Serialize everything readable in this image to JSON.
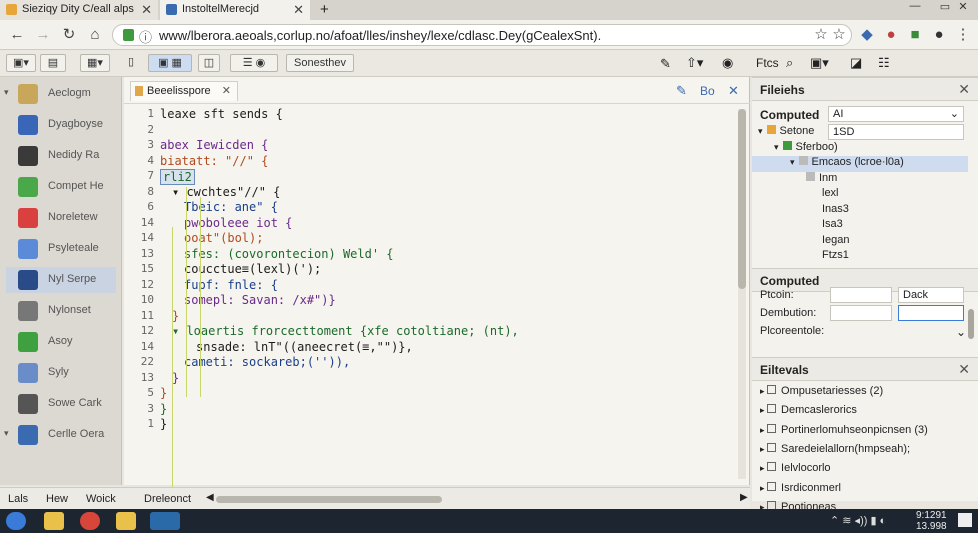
{
  "tabs": [
    {
      "title": "Sieziqy Dity C/eall alps"
    },
    {
      "title": "InstoltelMerecjd"
    }
  ],
  "new_tab_symbol": "+",
  "close_symbol": "✕",
  "address": {
    "url": "www/lberora.aeoals,corlup.no/afoat/lles/inshey/lexe/cdlasc.Dey(gCealexSnt)."
  },
  "devtools": {
    "selector_label": "Sonesthev",
    "right_label": "Ftcs"
  },
  "sidebar": {
    "items": [
      {
        "label": "Aeclogm",
        "color": "#c8a65a",
        "arrow": true
      },
      {
        "label": "Dyagboyse",
        "color": "#3a66b8"
      },
      {
        "label": "Nedidy Ra",
        "color": "#3a3a3a"
      },
      {
        "label": "Compet He",
        "color": "#4aa84a"
      },
      {
        "label": "Noreletew",
        "color": "#d94040"
      },
      {
        "label": "Psyleteale",
        "color": "#5a8ad8"
      },
      {
        "label": "Nyl Serpe",
        "color": "#2a4a88",
        "selected": true
      },
      {
        "label": "Nylonset",
        "color": "#777777"
      },
      {
        "label": "Asoy",
        "color": "#3fa03f"
      },
      {
        "label": "Syly",
        "color": "#6a8cc8"
      },
      {
        "label": "Sowe Cark",
        "color": "#555555"
      },
      {
        "label": "Cerlle Oera",
        "color": "#3a6ab0",
        "arrow": true
      }
    ]
  },
  "editor": {
    "tab_title": "Beeelisspore",
    "lines": [
      {
        "n": "1",
        "text": "leaxe sft sends {",
        "indent": 0
      },
      {
        "n": "2",
        "text": "",
        "indent": 0
      },
      {
        "n": "3",
        "text": "abex Iewicden {",
        "indent": 0
      },
      {
        "n": "4",
        "text": "biatatt: \"//\" {",
        "indent": 0
      },
      {
        "n": "7",
        "text": "rli2",
        "indent": 0,
        "boxed": true
      },
      {
        "n": "8",
        "text": "▾ cwchtes\"//\" {",
        "indent": 1
      },
      {
        "n": "6",
        "text": "Tbeic: ane\" {",
        "indent": 2
      },
      {
        "n": "14",
        "text": "pwoboleee iot {",
        "indent": 2
      },
      {
        "n": "14",
        "text": "ooat\"(bol);",
        "indent": 2
      },
      {
        "n": "13",
        "text": "sfes: (covorontecion) Weld' {",
        "indent": 2
      },
      {
        "n": "15",
        "text": "coucctue≡(lexl)(');",
        "indent": 2
      },
      {
        "n": "12",
        "text": "fupf: fnle: {",
        "indent": 2
      },
      {
        "n": "10",
        "text": "somepl: Savan: /x#\")}",
        "indent": 2
      },
      {
        "n": "11",
        "text": "}",
        "indent": 1
      },
      {
        "n": "12",
        "text": "▾ loaertis frorcecttoment {xfe cotoltiane; (nt),",
        "indent": 1
      },
      {
        "n": "14",
        "text": "snsade: lnT\"((aneecret(≡,\"\")},",
        "indent": 3
      },
      {
        "n": "22",
        "text": "cameti: sockareb;('')),",
        "indent": 2
      },
      {
        "n": "13",
        "text": "}",
        "indent": 1
      },
      {
        "n": "5",
        "text": "}",
        "indent": 0
      },
      {
        "n": "3",
        "text": "}",
        "indent": 0
      },
      {
        "n": "1",
        "text": "}",
        "indent": 0
      }
    ],
    "tools": {
      "b": "Bo"
    }
  },
  "status": {
    "a": "Lals",
    "b": "Hew",
    "c": "Woick",
    "d": "Dreleonct"
  },
  "right": {
    "elements_title": "Fileiehs",
    "computed_label": "Computed",
    "computed_filter": "AI",
    "tree": [
      {
        "label": "Setone",
        "value": "1SD",
        "level": 0,
        "arrow": "▾"
      },
      {
        "label": "Sferboo)",
        "level": 1,
        "arrow": "▾"
      },
      {
        "label": "Emcaos (lcroe·l0a)",
        "level": 2,
        "arrow": "▾",
        "selected": true
      },
      {
        "label": "Inm",
        "level": 3
      },
      {
        "label": "lexl",
        "level": 4
      },
      {
        "label": "Inas3",
        "level": 4
      },
      {
        "label": "Isa3",
        "level": 4
      },
      {
        "label": "Iegan",
        "level": 4
      },
      {
        "label": "Ftzs1",
        "level": 4
      }
    ],
    "computed2_title": "Computed",
    "fields": [
      {
        "label": "Ptcoin:",
        "value": "",
        "extra": "Dack"
      },
      {
        "label": "Dembution:",
        "value": ""
      },
      {
        "label": "Plcoreentole:",
        "value": ""
      }
    ],
    "events_title": "Eiltevals",
    "events": [
      {
        "label": "Ompusetariesses (2)"
      },
      {
        "label": "Demcaslerorics"
      },
      {
        "label": "Portinerlomuhseonpicnsen (3)"
      },
      {
        "label": "Saredeielallorn(hmpseah);"
      },
      {
        "label": "Ielvlocorlo"
      },
      {
        "label": "Isrdiconmerl"
      },
      {
        "label": "Pootioneas"
      }
    ]
  },
  "taskbar": {
    "time": "9:1291",
    "date": "13.998"
  }
}
